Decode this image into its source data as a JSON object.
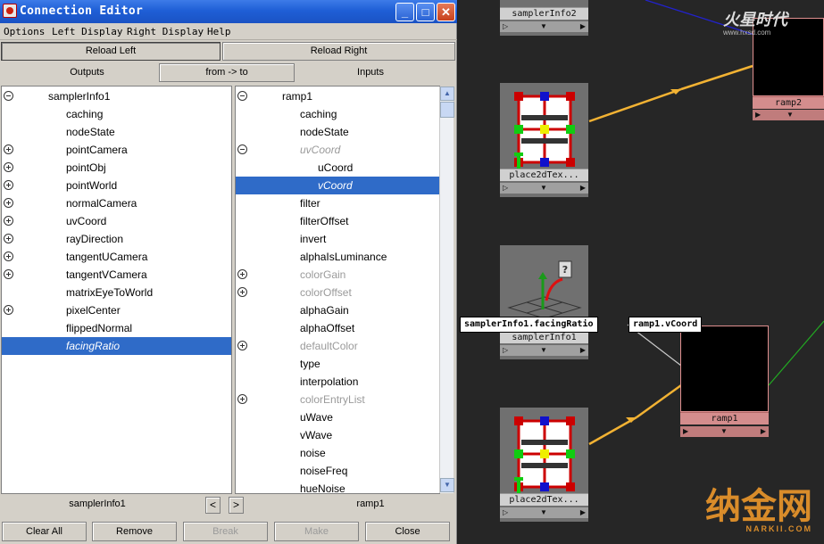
{
  "window": {
    "title": "Connection Editor",
    "controls": {
      "min": "_",
      "max": "□",
      "close": "✕"
    }
  },
  "menu": [
    "Options",
    "Left Display",
    "Right Display",
    "Help"
  ],
  "reload": {
    "left": "Reload Left",
    "right": "Reload Right"
  },
  "headers": {
    "outputs": "Outputs",
    "direction": "from -> to",
    "inputs": "Inputs"
  },
  "left_list": [
    {
      "label": "samplerInfo1",
      "expander": "open",
      "level": 0
    },
    {
      "label": "caching",
      "level": 1
    },
    {
      "label": "nodeState",
      "level": 1
    },
    {
      "label": "pointCamera",
      "expander": "closed",
      "level": 1
    },
    {
      "label": "pointObj",
      "expander": "closed",
      "level": 1
    },
    {
      "label": "pointWorld",
      "expander": "closed",
      "level": 1
    },
    {
      "label": "normalCamera",
      "expander": "closed",
      "level": 1
    },
    {
      "label": "uvCoord",
      "expander": "closed",
      "level": 1
    },
    {
      "label": "rayDirection",
      "expander": "closed",
      "level": 1
    },
    {
      "label": "tangentUCamera",
      "expander": "closed",
      "level": 1
    },
    {
      "label": "tangentVCamera",
      "expander": "closed",
      "level": 1
    },
    {
      "label": "matrixEyeToWorld",
      "level": 1
    },
    {
      "label": "pixelCenter",
      "expander": "closed",
      "level": 1
    },
    {
      "label": "flippedNormal",
      "level": 1
    },
    {
      "label": "facingRatio",
      "level": 1,
      "selected": true
    }
  ],
  "right_list": [
    {
      "label": "ramp1",
      "expander": "open",
      "level": 0
    },
    {
      "label": "caching",
      "level": 1
    },
    {
      "label": "nodeState",
      "level": 1
    },
    {
      "label": "uvCoord",
      "expander": "open",
      "level": 1,
      "style": "dimit"
    },
    {
      "label": "uCoord",
      "level": 2
    },
    {
      "label": "vCoord",
      "level": 2,
      "selected": true
    },
    {
      "label": "filter",
      "level": 1
    },
    {
      "label": "filterOffset",
      "level": 1
    },
    {
      "label": "invert",
      "level": 1
    },
    {
      "label": "alphaIsLuminance",
      "level": 1
    },
    {
      "label": "colorGain",
      "expander": "closed",
      "level": 1,
      "style": "dim"
    },
    {
      "label": "colorOffset",
      "expander": "closed",
      "level": 1,
      "style": "dim"
    },
    {
      "label": "alphaGain",
      "level": 1
    },
    {
      "label": "alphaOffset",
      "level": 1
    },
    {
      "label": "defaultColor",
      "expander": "closed",
      "level": 1,
      "style": "dim"
    },
    {
      "label": "type",
      "level": 1
    },
    {
      "label": "interpolation",
      "level": 1
    },
    {
      "label": "colorEntryList",
      "expander": "closed",
      "level": 1,
      "style": "dim"
    },
    {
      "label": "uWave",
      "level": 1
    },
    {
      "label": "vWave",
      "level": 1
    },
    {
      "label": "noise",
      "level": 1
    },
    {
      "label": "noiseFreq",
      "level": 1
    },
    {
      "label": "hueNoise",
      "level": 1
    }
  ],
  "footer": {
    "left_node": "samplerInfo1",
    "prev": "<",
    "next": ">",
    "right_node": "ramp1"
  },
  "bottom_buttons": [
    {
      "label": "Clear All",
      "enabled": true
    },
    {
      "label": "Remove",
      "enabled": true
    },
    {
      "label": "Break",
      "enabled": false
    },
    {
      "label": "Make",
      "enabled": false
    },
    {
      "label": "Close",
      "enabled": true
    }
  ],
  "graph": {
    "nodes": {
      "samplerinfo2": "samplerInfo2",
      "ramp2": "ramp2",
      "place2d_top": "place2dTex...",
      "samplerinfo1": "samplerInfo1",
      "ramp1": "ramp1",
      "place2d_bottom": "place2dTex..."
    },
    "tooltips": {
      "output": "samplerInfo1.facingRatio",
      "input": "ramp1.vCoord"
    },
    "connection_colors": {
      "selected": "#f2b233",
      "blue": "#2222cc",
      "green": "#22aa22",
      "white": "#cccccc"
    }
  },
  "watermarks": {
    "top": "火星时代",
    "top_url": "www.hxsd.com",
    "bottom": "纳金网",
    "bottom_url": "NARKII.COM"
  }
}
